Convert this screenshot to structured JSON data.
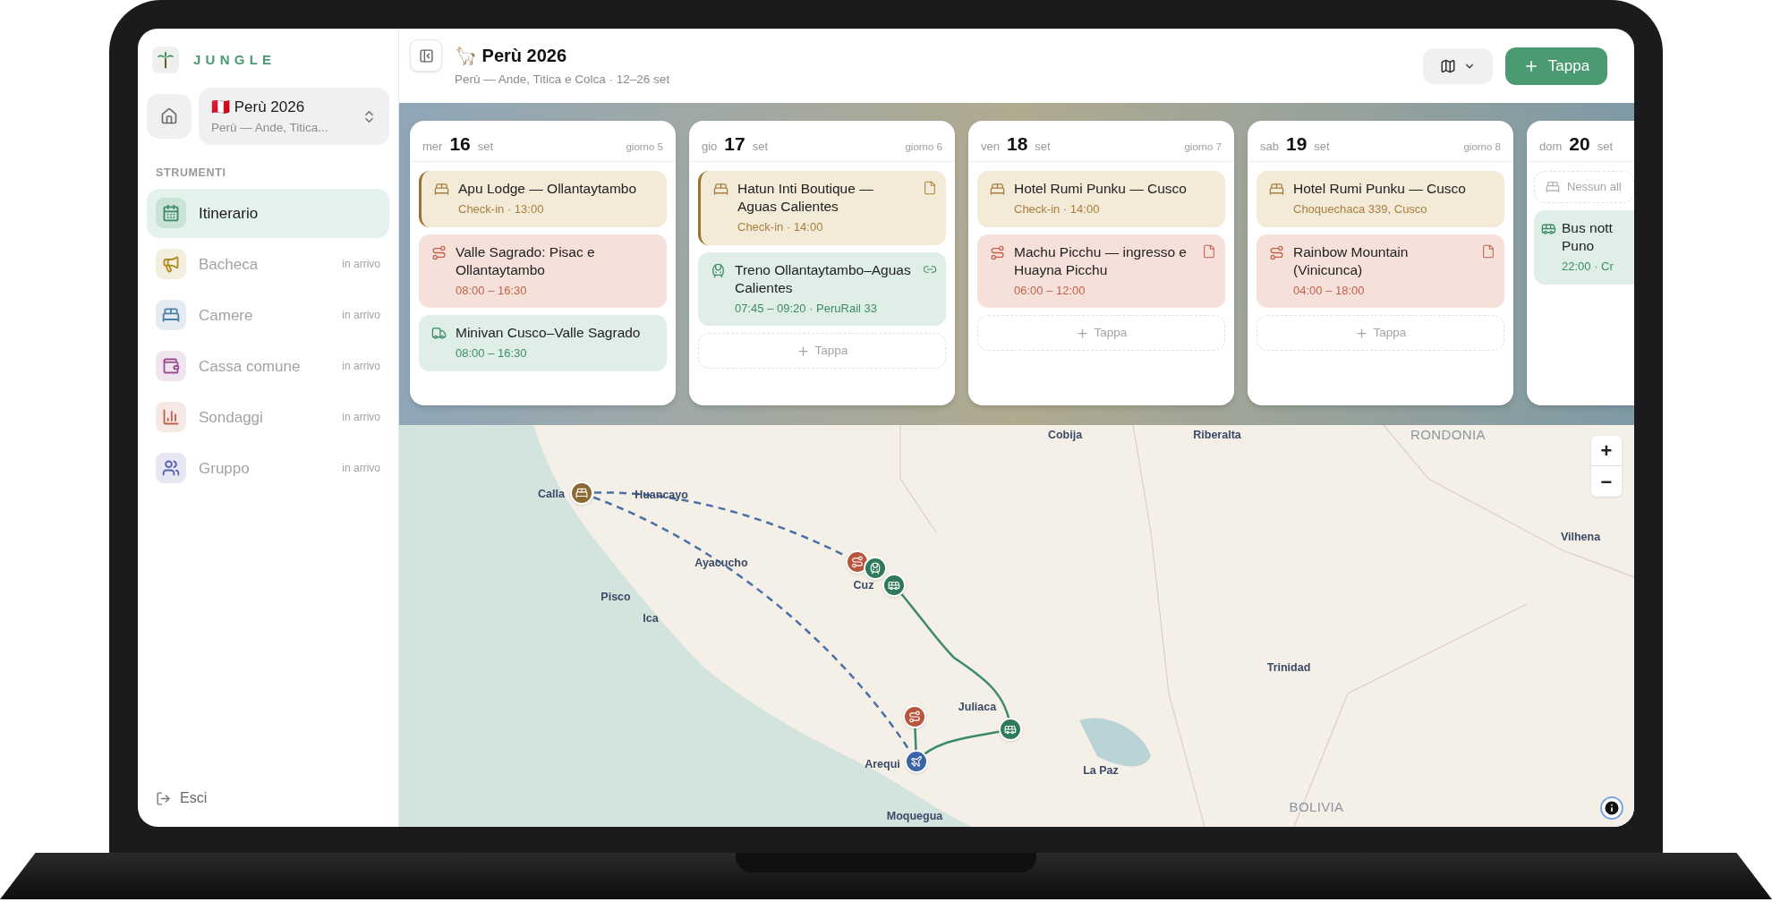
{
  "sidebar": {
    "brand": "JUNGLE",
    "trip": {
      "flag": "🇵🇪",
      "title": "Perù 2026",
      "subtitle": "Perù — Ande, Titica..."
    },
    "section": "STRUMENTI",
    "items": [
      {
        "label": "Itinerario",
        "color": "#3d8a68",
        "selected": true,
        "disabled": false
      },
      {
        "label": "Bacheca",
        "color": "#b08a1f",
        "selected": false,
        "disabled": true,
        "badge": "in arrivo"
      },
      {
        "label": "Camere",
        "color": "#4a7fa8",
        "selected": false,
        "disabled": true,
        "badge": "in arrivo"
      },
      {
        "label": "Cassa comune",
        "color": "#9a4f8f",
        "selected": false,
        "disabled": true,
        "badge": "in arrivo"
      },
      {
        "label": "Sondaggi",
        "color": "#c0624a",
        "selected": false,
        "disabled": true,
        "badge": "in arrivo"
      },
      {
        "label": "Gruppo",
        "color": "#5a5fb0",
        "selected": false,
        "disabled": true,
        "badge": "in arrivo"
      }
    ],
    "logout": "Esci"
  },
  "header": {
    "emoji": "🦙",
    "title": "Perù 2026",
    "subtitle": "Perù — Ande, Titica e Colca · 12–26 set",
    "add_button": "Tappa"
  },
  "days": [
    {
      "weekday": "mer",
      "day": "16",
      "month": "set",
      "index": "giorno 5",
      "events": [
        {
          "kind": "lodging",
          "title": "Apu Lodge — Ollantaytambo",
          "detail": "Check-in · 13:00",
          "highlighted": true,
          "note": false,
          "link": false
        },
        {
          "kind": "activity",
          "title": "Valle Sagrado: Pisac e Ollantaytambo",
          "detail": "08:00 – 16:30",
          "highlighted": false,
          "note": false,
          "link": false
        },
        {
          "kind": "van",
          "title": "Minivan Cusco–Valle Sagrado",
          "detail": "08:00 – 16:30",
          "highlighted": false,
          "note": false,
          "link": false
        }
      ]
    },
    {
      "weekday": "gio",
      "day": "17",
      "month": "set",
      "index": "giorno 6",
      "add": "Tappa",
      "events": [
        {
          "kind": "lodging",
          "title": "Hatun Inti Boutique — Aguas Calientes",
          "detail": "Check-in · 14:00",
          "highlighted": true,
          "note": true,
          "link": false
        },
        {
          "kind": "train",
          "title": "Treno Ollantaytambo–Aguas Calientes",
          "detail": "07:45 – 09:20 · PeruRail 33",
          "highlighted": false,
          "note": false,
          "link": true
        }
      ]
    },
    {
      "weekday": "ven",
      "day": "18",
      "month": "set",
      "index": "giorno 7",
      "add": "Tappa",
      "events": [
        {
          "kind": "lodging",
          "title": "Hotel Rumi Punku — Cusco",
          "detail": "Check-in · 14:00",
          "highlighted": false,
          "note": false,
          "link": false
        },
        {
          "kind": "activity",
          "title": "Machu Picchu — ingresso e Huayna Picchu",
          "detail": "06:00 – 12:00",
          "highlighted": false,
          "note": true,
          "link": false
        }
      ]
    },
    {
      "weekday": "sab",
      "day": "19",
      "month": "set",
      "index": "giorno 8",
      "add": "Tappa",
      "events": [
        {
          "kind": "lodging",
          "title": "Hotel Rumi Punku — Cusco",
          "detail": "Choquechaca 339, Cusco",
          "highlighted": false,
          "note": false,
          "link": false
        },
        {
          "kind": "activity",
          "title": "Rainbow Mountain (Vinicunca)",
          "detail": "04:00 – 18:00",
          "highlighted": false,
          "note": true,
          "link": false
        }
      ]
    },
    {
      "weekday": "dom",
      "day": "20",
      "month": "set",
      "empty_lodging": "Nessun all",
      "events": [
        {
          "kind": "bus",
          "title": "Bus nott Puno",
          "detail": "22:00 · Cr",
          "highlighted": false,
          "note": false,
          "link": false
        }
      ]
    }
  ],
  "map": {
    "labels": [
      "Cobija",
      "Riberalta",
      "RONDONIA",
      "Calla",
      "Huancayo",
      "Ayacucho",
      "Pisco",
      "Ica",
      "Cuz",
      "Vilhena",
      "Trinidad",
      "Juliaca",
      "Arequi",
      "La Paz",
      "Moquegua",
      "BOLIVIA"
    ],
    "markers": [
      {
        "kind": "lodging"
      },
      {
        "kind": "activity"
      },
      {
        "kind": "train"
      },
      {
        "kind": "bus"
      },
      {
        "kind": "activity"
      },
      {
        "kind": "bus"
      },
      {
        "kind": "flight"
      }
    ],
    "zoom_in": "+",
    "zoom_out": "−"
  }
}
